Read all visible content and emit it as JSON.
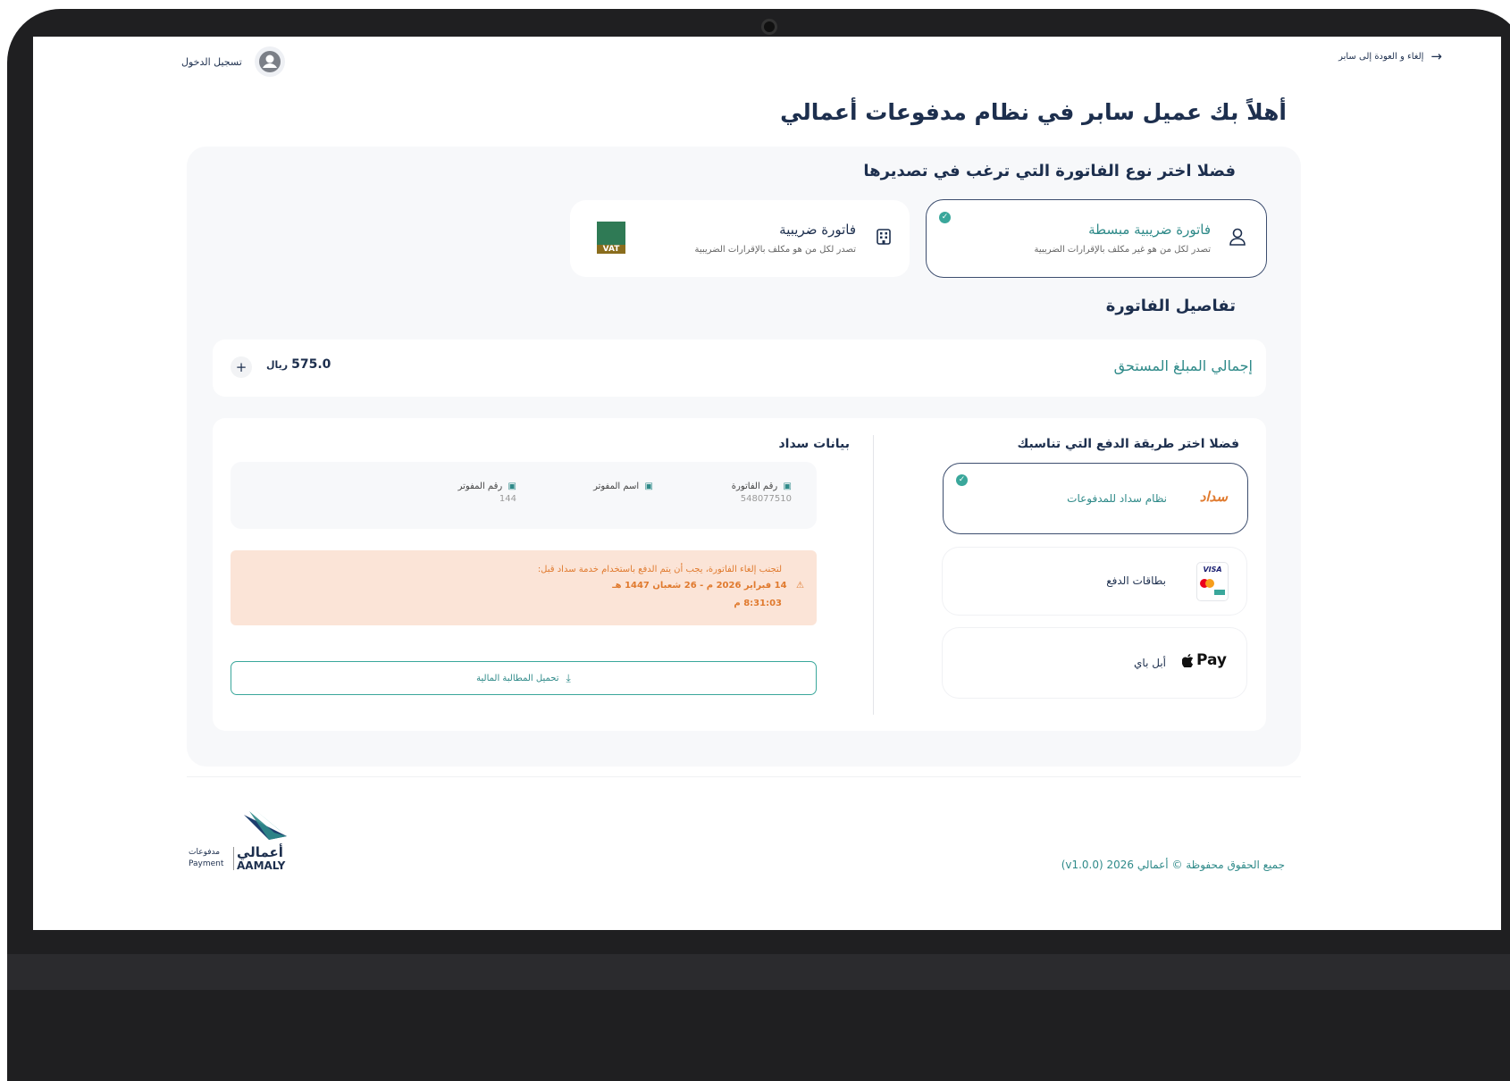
{
  "header": {
    "login_label": "تسجيل الدخول",
    "cancel_back_label": "إلغاء و العودة إلى سابر"
  },
  "welcome_title": "أهلاً بك عميل سابر في نظام مدفوعات أعمالي",
  "invoice_type": {
    "title": "فضلا اختر نوع الفاتورة التي ترغب في تصديرها",
    "options": [
      {
        "title": "فاتورة ضريبية مبسطة",
        "subtitle": "تصدر لكل من هو غير مكلف بالإقرارات الضريبية",
        "selected": true
      },
      {
        "title": "فاتورة ضريبية",
        "subtitle": "تصدر لكل من هو مكلف بالإقرارات الضريبية",
        "selected": false,
        "badge_text": "VAT"
      }
    ]
  },
  "invoice_details": {
    "title": "تفاصيل الفاتورة",
    "total_label": "إجمالي المبلغ المستحق",
    "total_value": "575.0",
    "currency_symbol": "ريال"
  },
  "payment": {
    "title": "فضلا اختر طريقة الدفع التي تناسبك",
    "methods": [
      {
        "logo": "سداد",
        "label": "نظام سداد للمدفوعات",
        "selected": true
      },
      {
        "logo_icon": "cards-icon",
        "label": "بطاقات الدفع",
        "selected": false,
        "visa": "VISA"
      },
      {
        "logo": "Pay",
        "label": "أبل باي",
        "selected": false
      }
    ]
  },
  "sadad": {
    "title": "بيانات سداد",
    "fields": [
      {
        "label": "رقم الفاتورة",
        "value": "548077510"
      },
      {
        "label": "اسم المفوتر",
        "value": ""
      },
      {
        "label": "رقم المفوتر",
        "value": "144"
      }
    ],
    "warning_line1": "لتجنب إلغاء الفاتورة، يجب أن يتم الدفع باستخدام خدمة سداد قبل:",
    "warning_line2": "14 فبراير 2026 م - 26 شعبان 1447 هـ",
    "warning_line3": "8:31:03 م",
    "download_label": "تحميل المطالبة المالية"
  },
  "footer": {
    "copyright": "جميع الحقوق محفوظة © أعمالي 2026 (v1.0.0)",
    "logo_ar": "أعمالي",
    "logo_en": "AAMALY",
    "logo_tag_ar": "مدفوعات",
    "logo_tag_en": "Payment"
  },
  "colors": {
    "teal": "#2f8a89",
    "navy": "#1d2f4e",
    "orange": "#e07a2e",
    "warning_bg": "#fbe4d7"
  }
}
